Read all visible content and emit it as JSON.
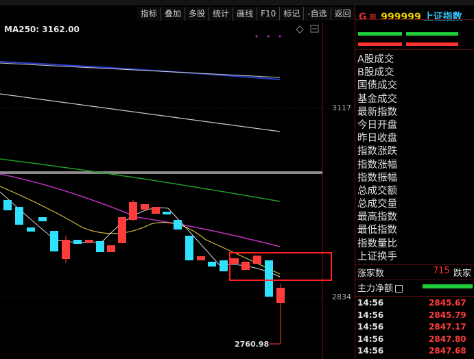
{
  "toolbar": {
    "buttons": [
      "指标",
      "叠加",
      "多股",
      "统计",
      "画线",
      "F10",
      "标记",
      "-自选",
      "返回"
    ]
  },
  "chart": {
    "ma_label": "MA250: 3162.00",
    "price_labels": {
      "upper": "3117",
      "lower": "2834"
    },
    "low_label": "2760.98",
    "colors": {
      "up": "#ff3c3c",
      "down": "#30e0ff",
      "ma_blue": "#2a3fd0",
      "ma_white": "#cccccc",
      "ma_green": "#22a022",
      "ma_magenta": "#c030c0",
      "ma_yellow": "#d8c040",
      "highlight": "#ff2020"
    }
  },
  "side": {
    "badge": "G",
    "badge_eq": "≡",
    "code": "999999",
    "name": "上证指数",
    "menu": [
      "A股成交",
      "B股成交",
      "国债成交",
      "基金成交",
      "最新指数",
      "今日开盘",
      "昨日收盘",
      "指数涨跌",
      "指数涨幅",
      "指数振幅",
      "总成交额",
      "总成交量",
      "最高指数",
      "最低指数",
      "指数量比",
      "上证换手"
    ],
    "rise_label": "涨家数",
    "rise_value": "715",
    "fall_label": "跌家",
    "netflow_label": "主力净额",
    "ticks": [
      {
        "time": "14:56",
        "price": "2845.67"
      },
      {
        "time": "14:56",
        "price": "2845.79"
      },
      {
        "time": "14:56",
        "price": "2847.17"
      },
      {
        "time": "14:56",
        "price": "2847.80"
      },
      {
        "time": "14:56",
        "price": "2847.68"
      }
    ]
  }
}
